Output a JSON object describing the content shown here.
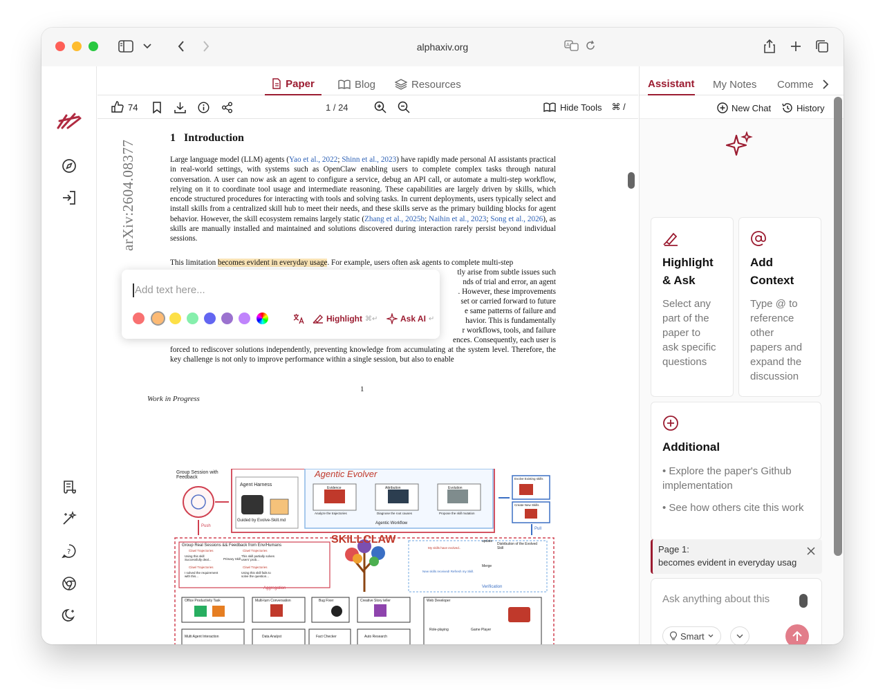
{
  "browser": {
    "url": "alphaxiv.org"
  },
  "tabs": [
    {
      "label": "Paper"
    },
    {
      "label": "Blog"
    },
    {
      "label": "Resources"
    }
  ],
  "toolbar": {
    "likes": "74",
    "page_indicator": "1 / 24",
    "hide_tools_label": "Hide Tools",
    "hide_tools_shortcut": "⌘ /"
  },
  "document": {
    "arxiv_id": "arXiv:2604.08377",
    "section_number": "1",
    "section_title": "Introduction",
    "para1": {
      "pre1": "Large language model (LLM) agents (",
      "cite1": "Yao et al., 2022",
      "mid1": "; ",
      "cite2": "Shinn et al., 2023",
      "post1": ") have rapidly made personal AI assistants practical in real-world settings, with systems such as OpenClaw enabling users to complete complex tasks through natural conversation. A user can now ask an agent to configure a service, debug an API call, or automate a multi-step workflow, relying on it to coordinate tool usage and intermediate reasoning. These capabilities are largely driven by skills, which encode structured procedures for interacting with tools and solving tasks. In current deployments, users typically select and install skills from a centralized skill hub to meet their needs, and these skills serve as the primary building blocks for agent behavior. However, the skill ecosystem remains largely static (",
      "cite3": "Zhang et al., 2025b",
      "mid2": "; ",
      "cite4": "Naihin et al., 2023",
      "mid3": "; ",
      "cite5": "Song et al., 2026",
      "post2": "), as skills are manually installed and maintained and solutions discovered during interaction rarely persist beyond individual sessions."
    },
    "para2": {
      "pre": "This limitation ",
      "highlighted": "becomes evident in everyday usage",
      "post": ". For example, users often ask agents to complete multi-step"
    },
    "para2_fragments": [
      "tly arise from subtle issues such",
      "nds of trial and error, an agent",
      ". However, these improvements",
      "set or carried forward to future",
      "e same patterns of failure and",
      "havior. This is fundamentally",
      "r workflows, tools, and failure",
      "ences. Consequently, each user is"
    ],
    "para2_tail": "forced to rediscover solutions independently, preventing knowledge from accumulating at the system level. Therefore, the key challenge is not only to improve performance within a single session, but also to enable",
    "page_number": "1",
    "footer": "Work in Progress"
  },
  "annotation_popup": {
    "placeholder": "Add text here...",
    "highlight_label": "Highlight",
    "highlight_shortcut": "⌘↵",
    "ask_ai_label": "Ask AI",
    "ask_ai_shortcut": "↵",
    "colors": [
      "#f87171",
      "#fdba74",
      "#fde047",
      "#86efac",
      "#6366f1",
      "#9b72cf",
      "#c084fc"
    ]
  },
  "figure": {
    "group_session": "Group Session with Feedback",
    "agentic_evolver": "Agentic Evolver",
    "agent_harness": "Agent Harness",
    "guided": "Guided by Evolve-Skill.md",
    "evidence": "Evidence",
    "attribution": "Attribution",
    "evolution": "Evolution",
    "analyze": "Analyze the trajectories",
    "diagnose": "Diagnose the root causes",
    "propose": "Propose the skill mutation",
    "agentic_workflow": "Agentic Workflow",
    "evolve_existing": "Evolve Existing skills",
    "create_new": "Create New Skills",
    "push": "Push",
    "pull": "Pull",
    "skillclaw": "SKILLCLAW",
    "group_real": "Group Real Sessions && Feedback from Env/Humans",
    "distribution": "Distribution of the Evolved Skill",
    "update": "update",
    "merge": "Merge",
    "verification": "Verification",
    "aggregation": "Aggregation",
    "skills_evolved": "My skills have evolved..",
    "new_skills": "New skills received! Refresh my Skill.",
    "traj1": "Clawl Trajectories",
    "traj2": "Clawl Trajectories",
    "traj3": "Clawl Trajectories",
    "traj4": "Clawl Trajectories",
    "note1": "Using this skill Successfully deal...",
    "note2": "This skill partially solves users' prob...",
    "note3": "I solved the requirement with this...",
    "note4": "Using this skill fails to solve the question...",
    "primary_skill": "Primary Skill",
    "tasks": [
      "Office Productivity Task",
      "Multi-turn Conversation",
      "Bug Fixer",
      "Creative Story teller",
      "Web Developer"
    ],
    "tasks2": [
      "Multi Agent Interaction",
      "Data Analyst",
      "Fact Checker",
      "Auto Research",
      "Role-playing",
      "Game Player"
    ]
  },
  "right_panel": {
    "tabs": [
      {
        "label": "Assistant"
      },
      {
        "label": "My Notes"
      },
      {
        "label": "Comme"
      }
    ],
    "new_chat": "New Chat",
    "history": "History",
    "card1": {
      "title_line1": "Highlight",
      "title_line2": "& Ask",
      "desc": [
        "Select any",
        "part of the",
        "paper to",
        "ask specific",
        "questions"
      ]
    },
    "card2": {
      "title_line1": "Add",
      "title_line2": "Context",
      "desc": [
        "Type @ to",
        "reference",
        "other",
        "papers and",
        "expand the",
        "discussion"
      ]
    },
    "card3": {
      "title": "Additional",
      "bullets": [
        "• Explore the paper's Github implementation",
        "• See how others cite this work"
      ]
    },
    "page_ref": {
      "page": "Page 1:",
      "quote": "becomes evident in everyday usag"
    },
    "chat": {
      "placeholder": "Ask anything about this",
      "model": "Smart"
    }
  }
}
